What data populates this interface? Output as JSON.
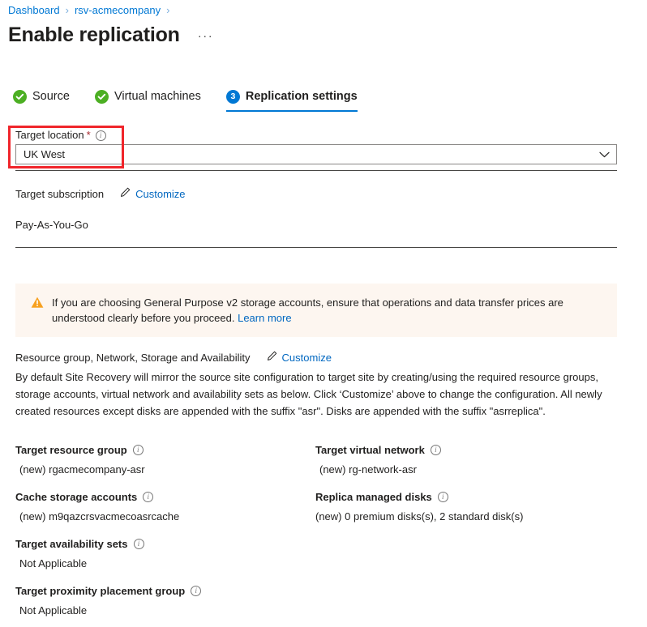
{
  "breadcrumb": {
    "items": [
      {
        "label": "Dashboard"
      },
      {
        "label": "rsv-acmecompany"
      }
    ],
    "separator": "›"
  },
  "header": {
    "title": "Enable replication",
    "more_actions": "···"
  },
  "tabs": [
    {
      "label": "Source",
      "state": "completed",
      "icon": "check-circle-icon"
    },
    {
      "label": "Virtual machines",
      "state": "completed",
      "icon": "check-circle-icon"
    },
    {
      "label": "Replication settings",
      "state": "active",
      "step": "3"
    }
  ],
  "target_location": {
    "label": "Target location",
    "required_marker": "*",
    "info_icon": "info-icon",
    "value": "UK West",
    "chevron": "chevron-down-icon"
  },
  "target_subscription": {
    "label": "Target subscription",
    "customize_label": "Customize",
    "value": "Pay-As-You-Go"
  },
  "warning": {
    "icon": "warning-triangle-icon",
    "text": "If you are choosing General Purpose v2 storage accounts, ensure that operations and data transfer prices are understood clearly before you proceed. ",
    "link_label": "Learn more"
  },
  "resource_section": {
    "heading": "Resource group, Network, Storage and Availability",
    "customize_label": "Customize",
    "description": "By default Site Recovery will mirror the source site configuration to target site by creating/using the required resource groups, storage accounts, virtual network and availability sets as below. Click ‘Customize’ above to change the configuration. All newly created resources except disks are appended with the suffix \"asr\". Disks are appended with the suffix \"asrreplica\"."
  },
  "details": [
    {
      "title": "Target resource group",
      "value": "(new) rgacmecompany-asr"
    },
    {
      "title": "Target virtual network",
      "value": "(new) rg-network-asr"
    },
    {
      "title": "Cache storage accounts",
      "value": "(new) m9qazcrsvacmecoasrcache"
    },
    {
      "title": "Replica managed disks",
      "value": "(new) 0 premium disks(s), 2 standard disk(s)"
    },
    {
      "title": "Target availability sets",
      "value": "Not Applicable"
    },
    {
      "title": "Target proximity placement group",
      "value": "Not Applicable"
    }
  ],
  "colors": {
    "accent_blue": "#0078d4",
    "link_blue": "#0067c0",
    "success_green": "#4caf23",
    "required_red": "#a4262c",
    "highlight_red": "#f0252b",
    "warning_bg": "#fdf6f0",
    "warning_orange": "#f7a01f"
  }
}
